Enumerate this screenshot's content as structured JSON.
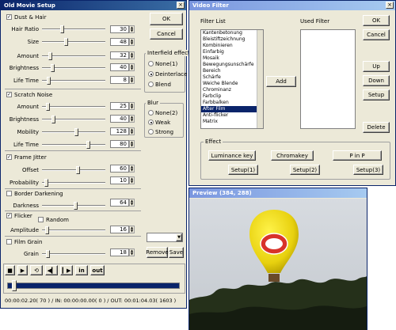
{
  "old_movie": {
    "title": "Old Movie Setup",
    "ok": "OK",
    "cancel": "Cancel",
    "dust_hair": "Dust & Hair",
    "hair_ratio": "Hair Ratio",
    "hair_ratio_val": "30",
    "size": "Size",
    "size_val": "48",
    "amount": "Amount",
    "amount_val": "32",
    "brightness": "Brightness",
    "brightness_val": "40",
    "life_time": "Life Time",
    "life_time_val": "8",
    "interfield": "Interfield effect",
    "none1": "None(1)",
    "deinterlace": "Deinterlace",
    "blend": "Blend",
    "scratch_noise": "Scratch Noise",
    "sn_amount": "Amount",
    "sn_amount_val": "25",
    "sn_brightness": "Brightness",
    "sn_brightness_val": "40",
    "mobility": "Mobility",
    "mobility_val": "128",
    "sn_life_time": "Life Time",
    "sn_life_time_val": "80",
    "blur": "Blur",
    "none2": "None(2)",
    "weak": "Weak",
    "strong": "Strong",
    "frame_jitter": "Frame Jitter",
    "offset": "Offset",
    "offset_val": "60",
    "probability": "Probability",
    "probability_val": "10",
    "border_darkening": "Border Darkening",
    "darkness": "Darkness",
    "darkness_val": "64",
    "flicker": "Flicker",
    "random": "Random",
    "amplitude": "Amplitude",
    "amplitude_val": "16",
    "film_grain": "Film Grain",
    "grain": "Grain",
    "grain_val": "18",
    "remove": "Remove",
    "save": "Save",
    "in": "in",
    "out": "out",
    "timecode": "00:00:02.20( 70 ) / IN: 00:00:00.00( 0 ) / OUT: 00:01:04.03( 1603 )"
  },
  "video_filter": {
    "title": "Video Filter",
    "filter_list_label": "Filter List",
    "used_filter_label": "Used Filter",
    "filters": [
      "Kantenbetonung",
      "Bleistiftzeichnung",
      "Kombinieren",
      "Einfarbig",
      "Mosaik",
      "Bewegungsunschärfe",
      "Bereich",
      "Schärfe",
      "Weiche Blende",
      "Chrominanz",
      "Farbclip",
      "Farbbalken",
      "After Film",
      "Anti-flicker",
      "Matrix"
    ],
    "selected_filter": "After Film",
    "add": "Add",
    "ok": "OK",
    "cancel": "Cancel",
    "up": "Up",
    "down": "Down",
    "setup": "Setup",
    "delete": "Delete",
    "effect": "Effect",
    "luminance_key": "Luminance key",
    "chromakey": "Chromakey",
    "pinp": "P in P",
    "setup1": "Setup(1)",
    "setup2": "Setup(2)",
    "setup3": "Setup(3)"
  },
  "preview": {
    "title": "Preview (384, 288)"
  },
  "colors": {
    "title_active": "#0a246a",
    "title_inactive": "#7a96df",
    "face": "#ece9d8",
    "progress": "#0a246a"
  },
  "progress": {
    "position_fraction": 0.04
  }
}
